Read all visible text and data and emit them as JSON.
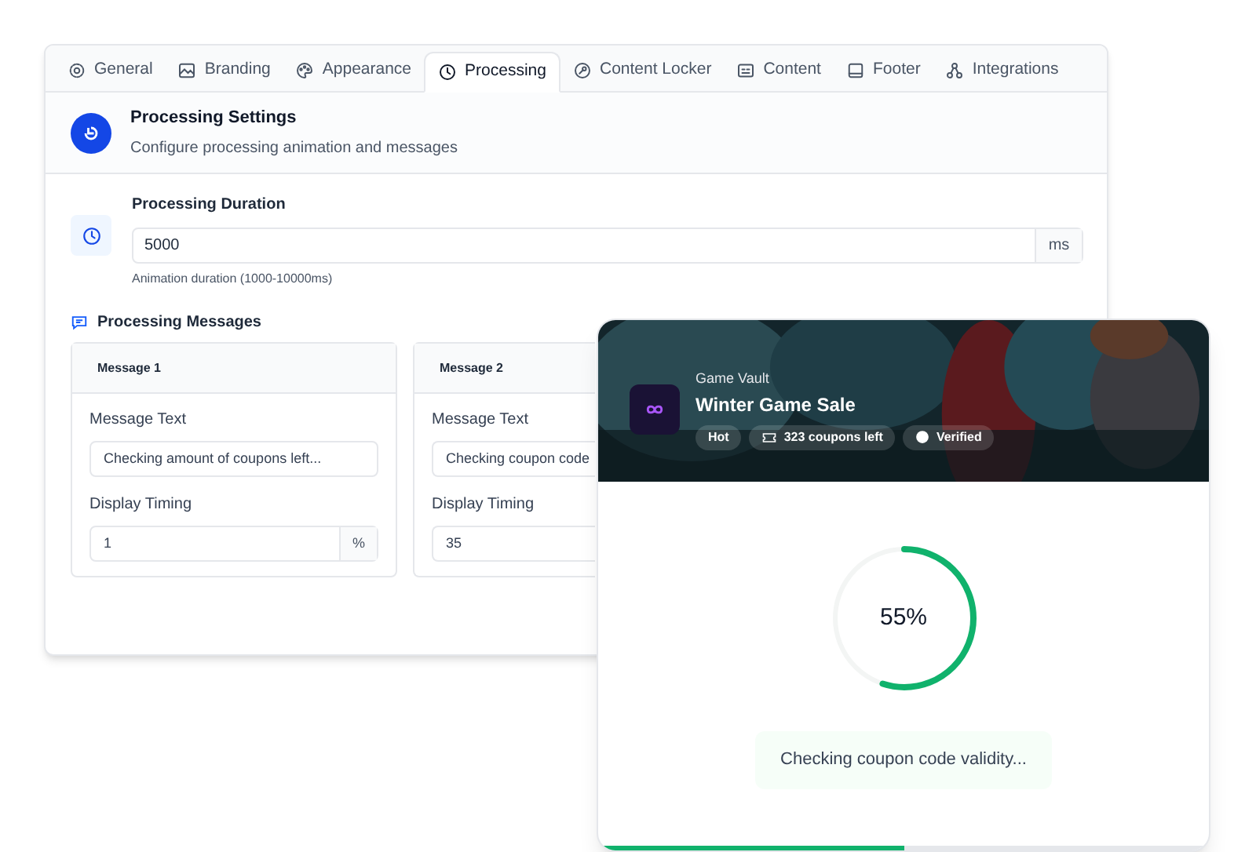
{
  "tabs": [
    {
      "label": "General",
      "selected": false
    },
    {
      "label": "Branding",
      "selected": false
    },
    {
      "label": "Appearance",
      "selected": false
    },
    {
      "label": "Processing",
      "selected": true
    },
    {
      "label": "Content Locker",
      "selected": false
    },
    {
      "label": "Content",
      "selected": false
    },
    {
      "label": "Footer",
      "selected": false
    },
    {
      "label": "Integrations",
      "selected": false
    }
  ],
  "header": {
    "title": "Processing Settings",
    "subtitle": "Configure processing animation and messages"
  },
  "duration": {
    "label": "Processing Duration",
    "value": "5000",
    "unit": "ms",
    "hint": "Animation duration (1000-10000ms)"
  },
  "messages": {
    "title": "Processing Messages",
    "items": [
      {
        "title": "Message 1",
        "text_label": "Message Text",
        "text": "Checking amount of coupons left...",
        "timing_label": "Display Timing",
        "timing": "1",
        "unit": "%"
      },
      {
        "title": "Message 2",
        "text_label": "Message Text",
        "text": "Checking coupon code",
        "timing_label": "Display Timing",
        "timing": "35"
      }
    ]
  },
  "preview": {
    "brand": "Game Vault",
    "title": "Winter Game Sale",
    "badges": [
      {
        "label": "Hot",
        "kind": "plain"
      },
      {
        "label": "323 coupons left",
        "kind": "ticket"
      },
      {
        "label": "Verified",
        "kind": "verified"
      }
    ],
    "progress": {
      "level": 0.55,
      "reading": "55%"
    },
    "message": "Checking coupon code validity...",
    "bar": {
      "level": 0.5
    }
  }
}
